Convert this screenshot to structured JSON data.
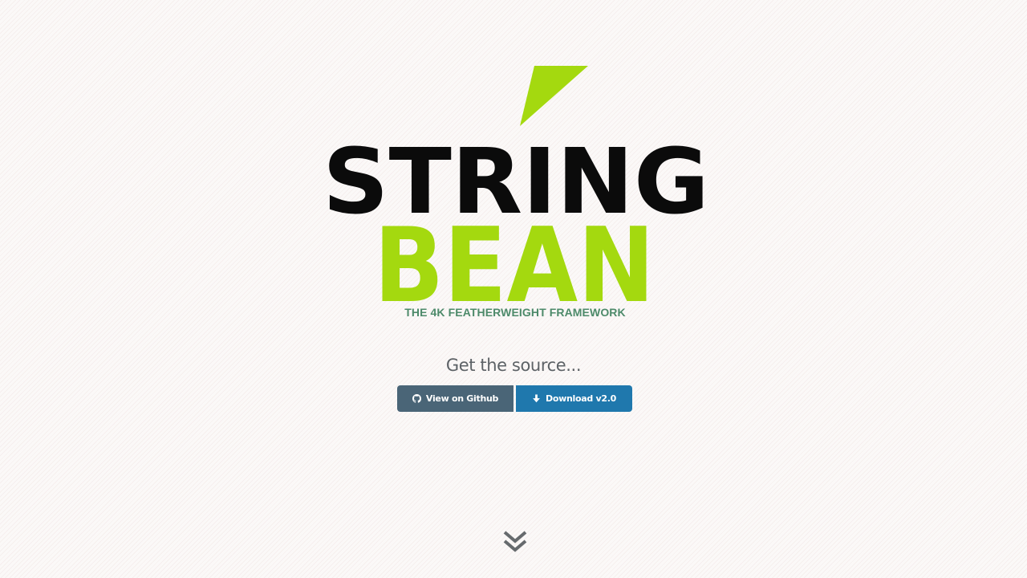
{
  "logo": {
    "word_top": "STRING",
    "word_bottom": "BEAN",
    "colors": {
      "dark": "#0b0b0b",
      "green": "#a4d90f"
    }
  },
  "tagline": "THE 4K FEATHERWEIGHT FRAMEWORK",
  "source": {
    "heading": "Get the source...",
    "buttons": [
      {
        "label": "View on Github",
        "icon": "github-icon",
        "color": "#4a6577"
      },
      {
        "label": "Download v2.0",
        "icon": "download-arrow-icon",
        "color": "#1f78ad"
      }
    ]
  },
  "scroll_indicator": {
    "icon": "double-chevron-down-icon",
    "color": "#666a6d"
  }
}
